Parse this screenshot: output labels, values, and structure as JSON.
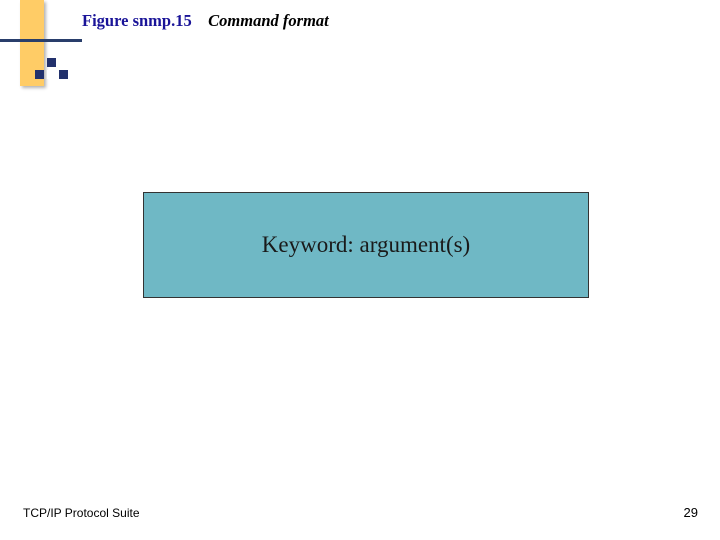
{
  "title": {
    "figure_label": "Figure snmp.15",
    "figure_desc": "Command format"
  },
  "diagram": {
    "text": "Keyword: argument(s)"
  },
  "footer": {
    "left": "TCP/IP Protocol Suite",
    "page_number": "29"
  }
}
